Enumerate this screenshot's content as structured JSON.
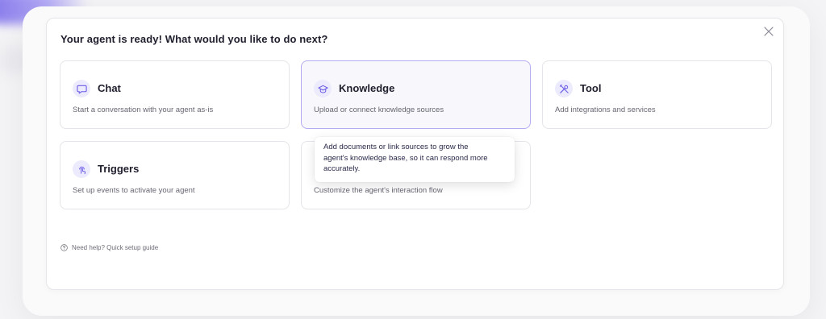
{
  "modal": {
    "title": "Your agent is ready! What would you like to do next?",
    "close_icon": "close-icon"
  },
  "cards": [
    {
      "id": "chat",
      "title": "Chat",
      "description": "Start a conversation with your agent as-is",
      "icon": "chat-bubble-icon"
    },
    {
      "id": "knowledge",
      "title": "Knowledge",
      "description": "Upload or connect knowledge sources",
      "icon": "graduation-cap-icon",
      "state": "hovered"
    },
    {
      "id": "tool",
      "title": "Tool",
      "description": "Add integrations and services",
      "icon": "tools-icon"
    },
    {
      "id": "triggers",
      "title": "Triggers",
      "description": "Set up events to activate your agent",
      "icon": "touch-icon"
    },
    {
      "id": "workflow",
      "title": "",
      "description": "Customize the agent's interaction flow",
      "icon": ""
    }
  ],
  "tooltip": {
    "line1": "Add documents or link sources to grow the",
    "line2": "agent's knowledge base, so it can respond more",
    "line3": "accurately."
  },
  "help": {
    "label": "Need help? Quick setup guide",
    "icon": "question-circle-icon"
  },
  "colors": {
    "accent": "#6c5ce7",
    "icon_bg": "#ecebfd",
    "active_border": "#b4acf2"
  }
}
